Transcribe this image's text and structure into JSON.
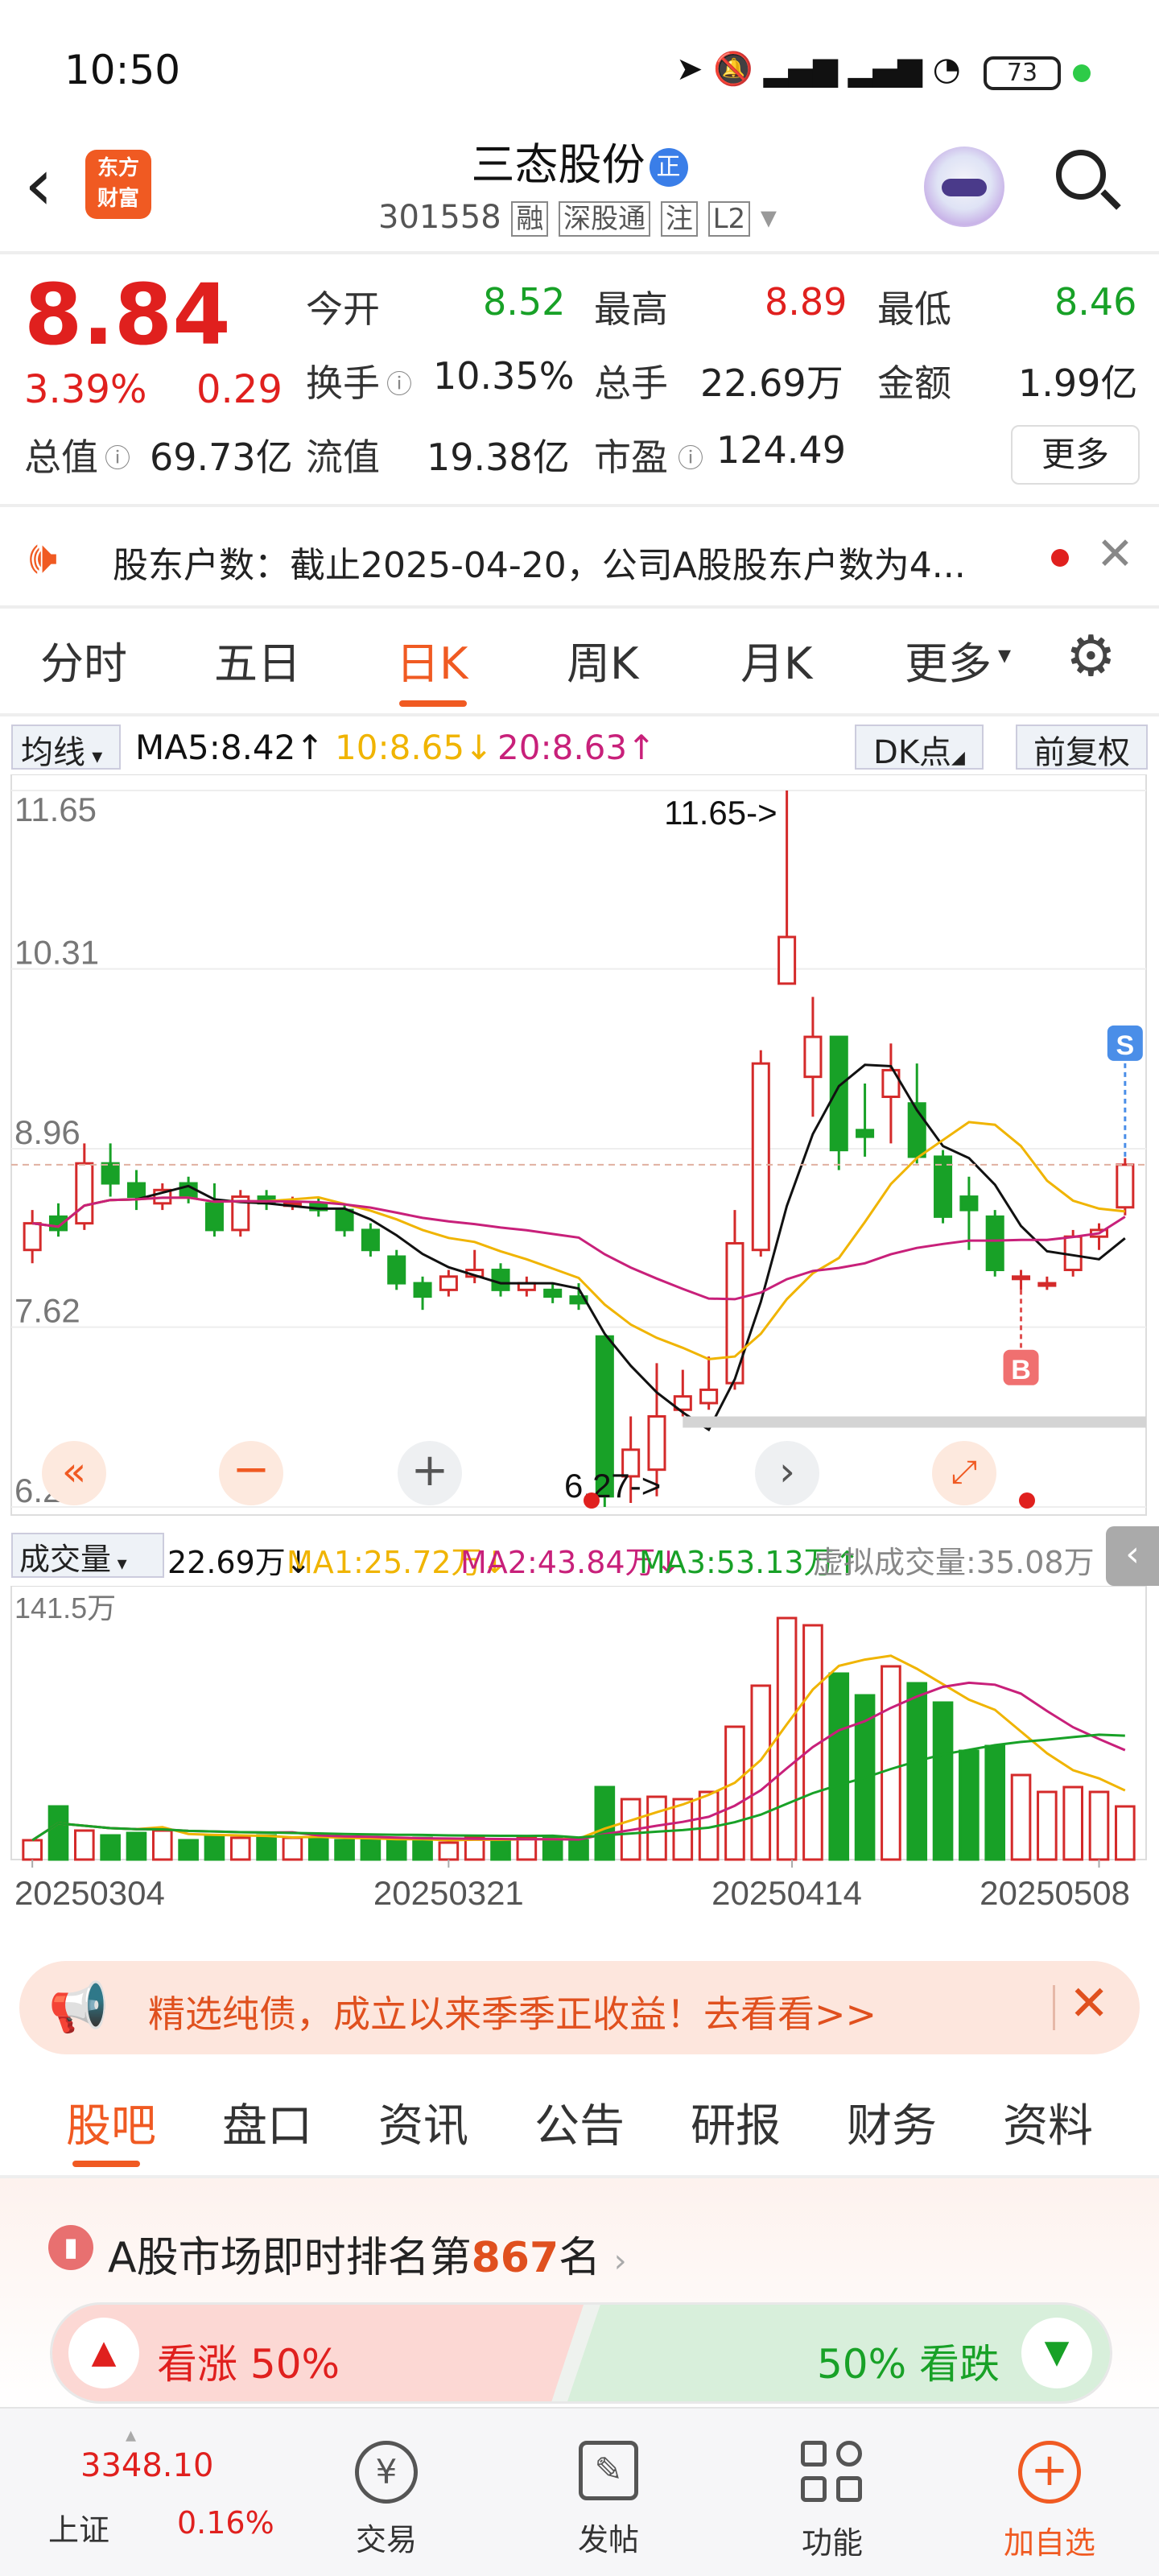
{
  "status_bar": {
    "time": "10:50",
    "battery": "73"
  },
  "header": {
    "title": "三态股份",
    "badge": "正",
    "code": "301558",
    "tags": [
      "融",
      "深股通",
      "注",
      "L2"
    ],
    "app_logo": "东方\n财富"
  },
  "quote": {
    "price": "8.84",
    "change_pct": "3.39%",
    "change": "0.29",
    "rows": [
      [
        {
          "l": "今开",
          "v": "8.52",
          "c": "green"
        },
        {
          "l": "最高",
          "v": "8.89",
          "c": "red"
        },
        {
          "l": "最低",
          "v": "8.46",
          "c": "green"
        }
      ],
      [
        {
          "l": "换手",
          "v": "10.35%",
          "c": "dark"
        },
        {
          "l": "总手",
          "v": "22.69万",
          "c": "dark"
        },
        {
          "l": "金额",
          "v": "1.99亿",
          "c": "dark"
        }
      ],
      [
        {
          "l": "总值",
          "v": "69.73亿",
          "c": "dark"
        },
        {
          "l": "流值",
          "v": "19.38亿",
          "c": "dark"
        },
        {
          "l": "市盈",
          "v": "124.49",
          "c": "dark"
        }
      ]
    ],
    "more": "更多"
  },
  "notice": {
    "text": "股东户数：截止2025-04-20，公司A股股东户数为4..."
  },
  "chart_tabs": [
    "分时",
    "五日",
    "日K",
    "周K",
    "月K",
    "更多"
  ],
  "active_tab": "日K",
  "legend": {
    "type": "均线",
    "ma5": "MA5:8.42",
    "ma10": "10:8.65",
    "ma20": "20:8.63",
    "dk": "DK点",
    "adj": "前复权"
  },
  "chart_data": {
    "type": "candlestick",
    "y_ticks": [
      "11.65",
      "10.31",
      "8.96",
      "7.62",
      "6.27"
    ],
    "high_label": "11.65->",
    "low_label": "6.27->",
    "markers": [
      "S",
      "B"
    ],
    "x_labels": [
      "20250304",
      "20250321",
      "20250414",
      "20250508"
    ],
    "candles": [
      {
        "o": 8.2,
        "c": 8.4,
        "h": 8.5,
        "l": 8.1
      },
      {
        "o": 8.45,
        "c": 8.35,
        "h": 8.55,
        "l": 8.3
      },
      {
        "o": 8.4,
        "c": 8.85,
        "h": 9.0,
        "l": 8.35
      },
      {
        "o": 8.85,
        "c": 8.7,
        "h": 9.0,
        "l": 8.6
      },
      {
        "o": 8.7,
        "c": 8.6,
        "h": 8.8,
        "l": 8.5
      },
      {
        "o": 8.55,
        "c": 8.65,
        "h": 8.7,
        "l": 8.5
      },
      {
        "o": 8.7,
        "c": 8.6,
        "h": 8.75,
        "l": 8.55
      },
      {
        "o": 8.55,
        "c": 8.35,
        "h": 8.7,
        "l": 8.3
      },
      {
        "o": 8.35,
        "c": 8.6,
        "h": 8.65,
        "l": 8.3
      },
      {
        "o": 8.6,
        "c": 8.55,
        "h": 8.65,
        "l": 8.5
      },
      {
        "o": 8.55,
        "c": 8.55,
        "h": 8.6,
        "l": 8.5
      },
      {
        "o": 8.55,
        "c": 8.5,
        "h": 8.6,
        "l": 8.45
      },
      {
        "o": 8.5,
        "c": 8.35,
        "h": 8.55,
        "l": 8.3
      },
      {
        "o": 8.35,
        "c": 8.2,
        "h": 8.4,
        "l": 8.15
      },
      {
        "o": 8.15,
        "c": 7.95,
        "h": 8.2,
        "l": 7.9
      },
      {
        "o": 7.95,
        "c": 7.85,
        "h": 8.0,
        "l": 7.75
      },
      {
        "o": 7.9,
        "c": 8.0,
        "h": 8.05,
        "l": 7.85
      },
      {
        "o": 8.0,
        "c": 8.05,
        "h": 8.2,
        "l": 7.95
      },
      {
        "o": 8.05,
        "c": 7.9,
        "h": 8.1,
        "l": 7.85
      },
      {
        "o": 7.9,
        "c": 7.95,
        "h": 8.0,
        "l": 7.85
      },
      {
        "o": 7.9,
        "c": 7.85,
        "h": 7.95,
        "l": 7.8
      },
      {
        "o": 7.85,
        "c": 7.8,
        "h": 7.95,
        "l": 7.75
      },
      {
        "o": 7.55,
        "c": 6.35,
        "h": 7.55,
        "l": 6.27
      },
      {
        "o": 6.5,
        "c": 6.7,
        "h": 6.95,
        "l": 6.3
      },
      {
        "o": 6.55,
        "c": 6.95,
        "h": 7.35,
        "l": 6.35
      },
      {
        "o": 7.0,
        "c": 7.1,
        "h": 7.3,
        "l": 6.95
      },
      {
        "o": 7.05,
        "c": 7.15,
        "h": 7.4,
        "l": 7.0
      },
      {
        "o": 7.2,
        "c": 8.25,
        "h": 8.5,
        "l": 7.15
      },
      {
        "o": 8.2,
        "c": 9.6,
        "h": 9.7,
        "l": 8.15
      },
      {
        "o": 10.2,
        "c": 10.55,
        "h": 11.65,
        "l": 10.2
      },
      {
        "o": 9.5,
        "c": 9.8,
        "h": 10.1,
        "l": 9.2
      },
      {
        "o": 9.8,
        "c": 8.95,
        "h": 9.8,
        "l": 8.8
      },
      {
        "o": 9.1,
        "c": 9.05,
        "h": 9.45,
        "l": 8.9
      },
      {
        "o": 9.35,
        "c": 9.55,
        "h": 9.75,
        "l": 9.0
      },
      {
        "o": 9.3,
        "c": 8.9,
        "h": 9.6,
        "l": 8.85
      },
      {
        "o": 8.9,
        "c": 8.45,
        "h": 8.95,
        "l": 8.4
      },
      {
        "o": 8.6,
        "c": 8.5,
        "h": 8.75,
        "l": 8.2
      },
      {
        "o": 8.45,
        "c": 8.05,
        "h": 8.5,
        "l": 8.0
      },
      {
        "o": 8.0,
        "c": 8.0,
        "h": 8.05,
        "l": 7.9
      },
      {
        "o": 7.95,
        "c": 7.95,
        "h": 8.0,
        "l": 7.9
      },
      {
        "o": 8.05,
        "c": 8.3,
        "h": 8.35,
        "l": 8.0
      },
      {
        "o": 8.3,
        "c": 8.35,
        "h": 8.4,
        "l": 8.2
      },
      {
        "o": 8.52,
        "c": 8.84,
        "h": 8.89,
        "l": 8.46
      }
    ]
  },
  "volume": {
    "label": "成交量",
    "value": "22.69万",
    "ma1": "MA1:25.72万",
    "ma2": "MA2:43.84万",
    "ma3": "MA3:53.13万",
    "virtual": "虚拟成交量:35.08万",
    "max": "141.5万"
  },
  "ad": {
    "text": "精选纯债，成立以来季季正收益！去看看>>"
  },
  "sub_tabs": [
    "股吧",
    "盘口",
    "资讯",
    "公告",
    "研报",
    "财务",
    "资料"
  ],
  "rank": {
    "prefix": "A股市场即时排名第",
    "num": "867",
    "suffix": "名"
  },
  "sentiment": {
    "up": "看涨 50%",
    "down": "50% 看跌"
  },
  "bottom": {
    "index_value": "3348.10",
    "index_name": "上证",
    "index_pct": "0.16%",
    "items": [
      "交易",
      "发帖",
      "功能",
      "加自选"
    ]
  }
}
